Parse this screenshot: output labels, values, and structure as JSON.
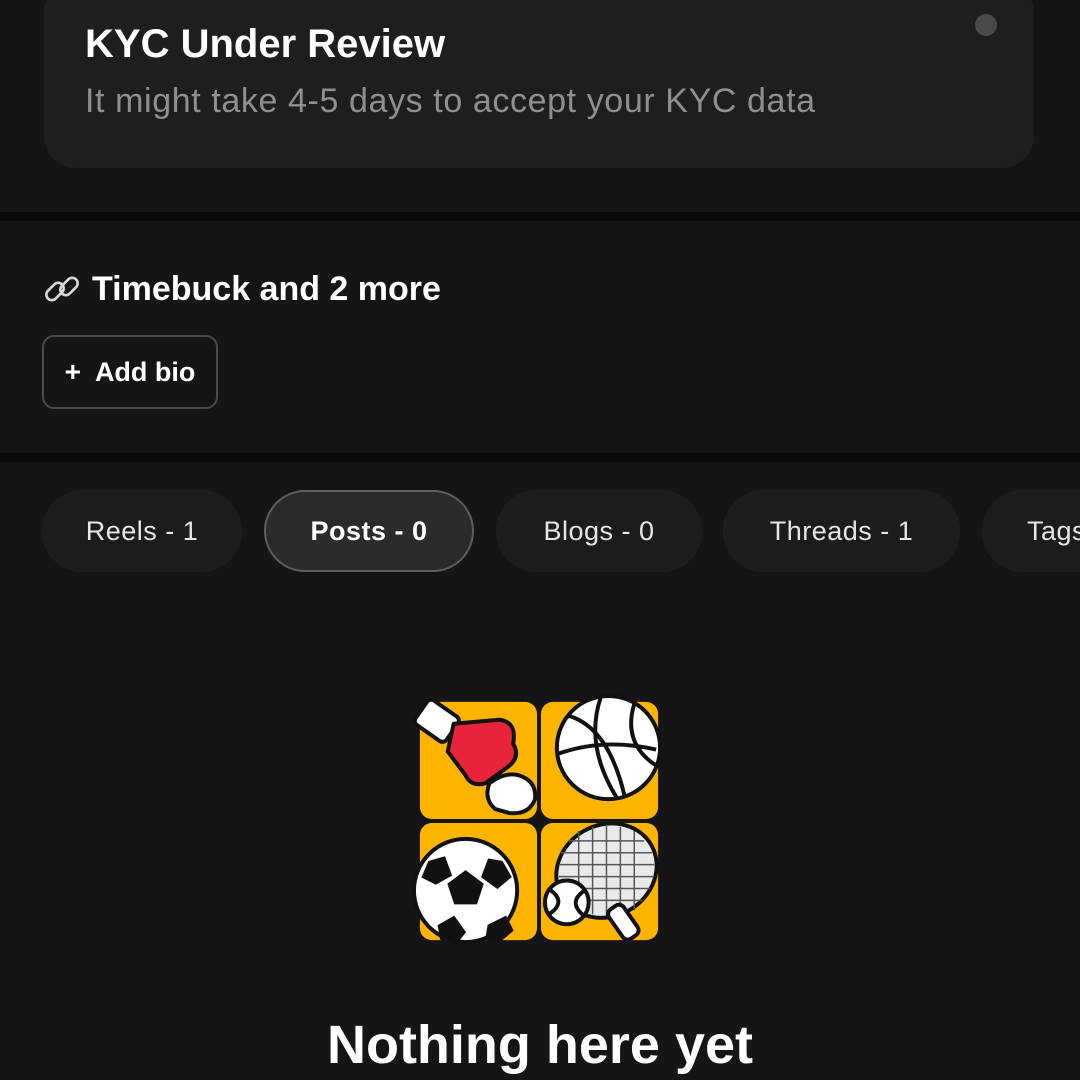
{
  "kyc": {
    "title": "KYC Under Review",
    "subtitle": "It might take 4-5 days to accept your KYC data"
  },
  "links": {
    "icon": "link-icon",
    "label": "Timebuck and 2 more"
  },
  "bio": {
    "add_icon": "plus-icon",
    "add_label": "Add bio"
  },
  "tabs": [
    {
      "label": "Reels - 1",
      "active": false
    },
    {
      "label": "Posts - 0",
      "active": true
    },
    {
      "label": "Blogs - 0",
      "active": false
    },
    {
      "label": "Threads - 1",
      "active": false
    },
    {
      "label": "Tags",
      "active": false
    }
  ],
  "empty_state": {
    "illustration": "sports-icons-illustration",
    "title": "Nothing here yet"
  },
  "colors": {
    "background": "#151515",
    "card": "#1e1e1e",
    "accent_yellow": "#ffb400",
    "glove_red": "#e8233a",
    "muted_text": "#8f8f8f"
  }
}
